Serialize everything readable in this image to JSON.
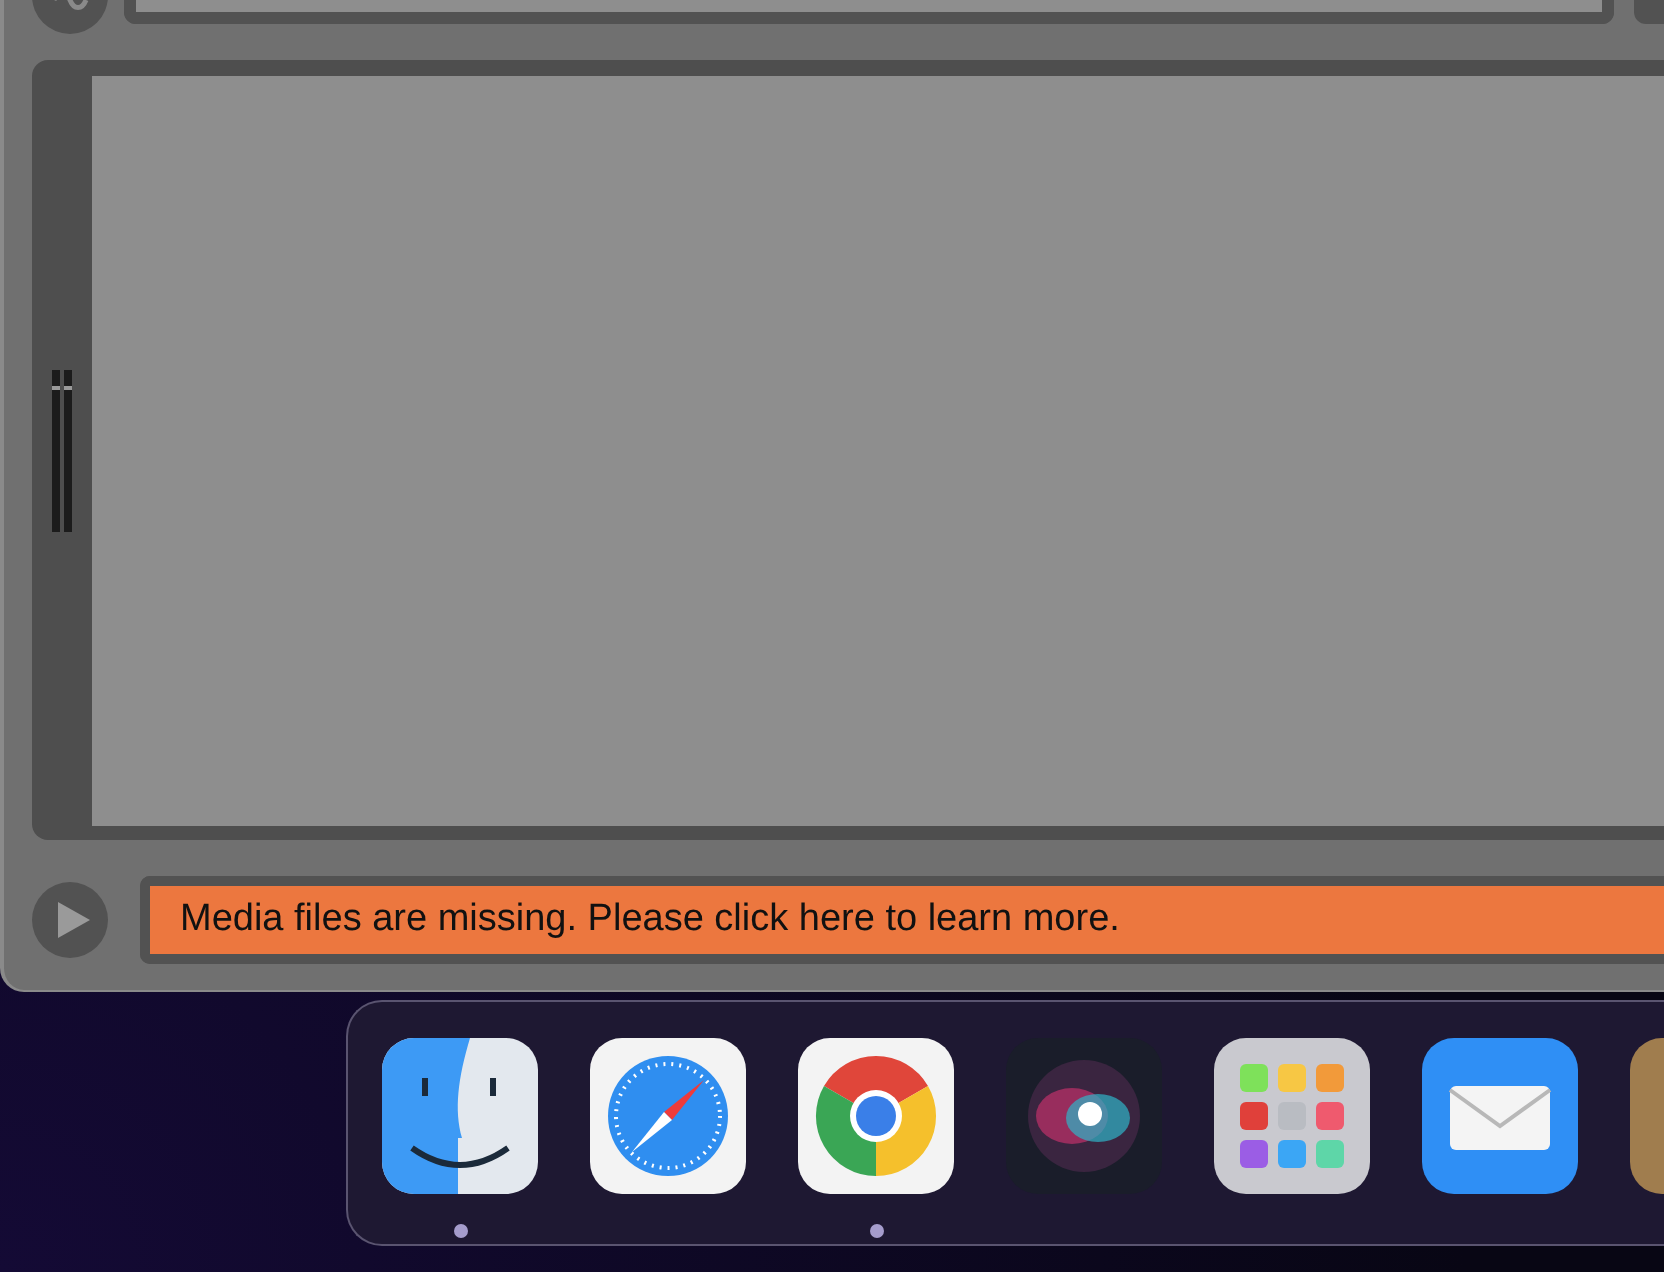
{
  "status_message": {
    "text": "Media files are missing. Please click here to learn more."
  },
  "dock": {
    "items": [
      {
        "kind": "finder",
        "running": true
      },
      {
        "kind": "safari",
        "running": false
      },
      {
        "kind": "chrome",
        "running": true
      },
      {
        "kind": "siri",
        "running": false
      },
      {
        "kind": "launchpad",
        "running": false
      },
      {
        "kind": "mail",
        "running": false
      },
      {
        "kind": "generic",
        "running": false
      }
    ]
  }
}
